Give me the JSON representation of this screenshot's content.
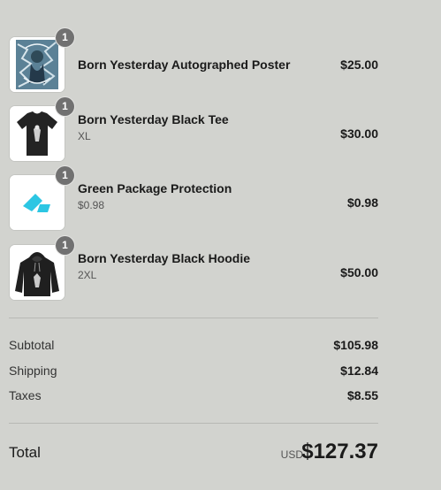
{
  "line_items": [
    {
      "name": "Born Yesterday Autographed Poster",
      "variant": "",
      "price": "$25.00",
      "quantity": "1",
      "image_icon": "poster-image"
    },
    {
      "name": "Born Yesterday Black Tee",
      "variant": "XL",
      "price": "$30.00",
      "quantity": "1",
      "image_icon": "tshirt-image"
    },
    {
      "name": "Green Package Protection",
      "variant": "$0.98",
      "price": "$0.98",
      "quantity": "1",
      "image_icon": "package-protection-logo"
    },
    {
      "name": "Born Yesterday Black Hoodie",
      "variant": "2XL",
      "price": "$50.00",
      "quantity": "1",
      "image_icon": "hoodie-image"
    }
  ],
  "totals": {
    "subtotal_label": "Subtotal",
    "subtotal_value": "$105.98",
    "shipping_label": "Shipping",
    "shipping_value": "$12.84",
    "taxes_label": "Taxes",
    "taxes_value": "$8.55",
    "total_label": "Total",
    "currency": "USD",
    "total_value": "$127.37"
  },
  "colors": {
    "background": "#d2d3cf",
    "badge": "#717171",
    "accent_protection": "#2cc6e3"
  }
}
